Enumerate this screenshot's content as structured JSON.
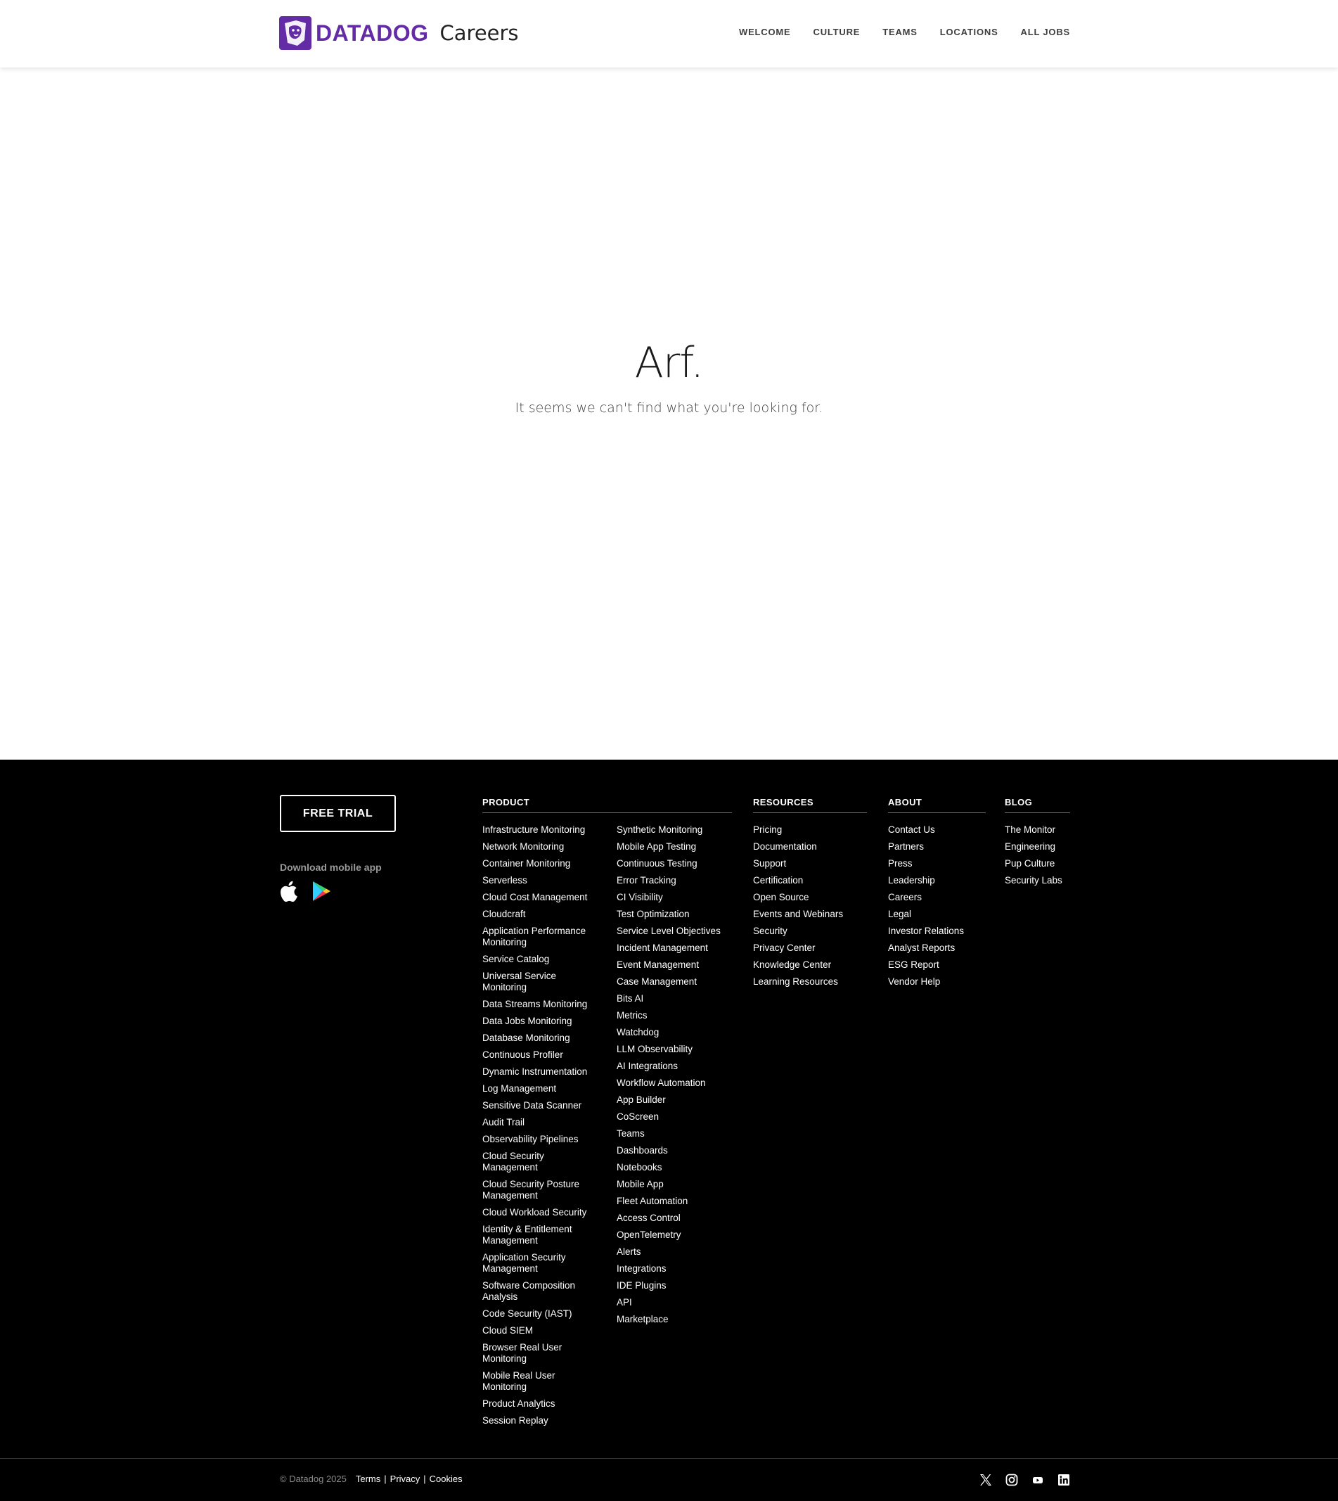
{
  "header": {
    "brand": "DATADOG",
    "subtitle": "Careers",
    "nav": [
      {
        "label": "WELCOME"
      },
      {
        "label": "CULTURE"
      },
      {
        "label": "TEAMS"
      },
      {
        "label": "LOCATIONS"
      },
      {
        "label": "ALL JOBS"
      }
    ]
  },
  "error": {
    "heading": "Arf.",
    "message": "It seems we can't find what you're looking for."
  },
  "footer": {
    "cta_label": "FREE TRIAL",
    "mobile_label": "Download mobile app",
    "store_icons": [
      "apple-icon",
      "google-play-icon"
    ],
    "columns": {
      "product": {
        "heading": "PRODUCT",
        "col1": [
          "Infrastructure Monitoring",
          "Network Monitoring",
          "Container Monitoring",
          "Serverless",
          "Cloud Cost Management",
          "Cloudcraft",
          "Application Performance Monitoring",
          "Service Catalog",
          "Universal Service Monitoring",
          "Data Streams Monitoring",
          "Data Jobs Monitoring",
          "Database Monitoring",
          "Continuous Profiler",
          "Dynamic Instrumentation",
          "Log Management",
          "Sensitive Data Scanner",
          "Audit Trail",
          "Observability Pipelines",
          "Cloud Security Management",
          "Cloud Security Posture Management",
          "Cloud Workload Security",
          "Identity & Entitlement Management",
          "Application Security Management",
          "Software Composition Analysis",
          "Code Security (IAST)",
          "Cloud SIEM",
          "Browser Real User Monitoring",
          "Mobile Real User Monitoring",
          "Product Analytics",
          "Session Replay"
        ],
        "col2": [
          "Synthetic Monitoring",
          "Mobile App Testing",
          "Continuous Testing",
          "Error Tracking",
          "CI Visibility",
          "Test Optimization",
          "Service Level Objectives",
          "Incident Management",
          "Event Management",
          "Case Management",
          "Bits AI",
          "Metrics",
          "Watchdog",
          "LLM Observability",
          "AI Integrations",
          "Workflow Automation",
          "App Builder",
          "CoScreen",
          "Teams",
          "Dashboards",
          "Notebooks",
          "Mobile App",
          "Fleet Automation",
          "Access Control",
          "OpenTelemetry",
          "Alerts",
          "Integrations",
          "IDE Plugins",
          "API",
          "Marketplace"
        ]
      },
      "resources": {
        "heading": "RESOURCES",
        "items": [
          "Pricing",
          "Documentation",
          "Support",
          "Certification",
          "Open Source",
          "Events and Webinars",
          "Security",
          "Privacy Center",
          "Knowledge Center",
          "Learning Resources"
        ]
      },
      "about": {
        "heading": "ABOUT",
        "items": [
          "Contact Us",
          "Partners",
          "Press",
          "Leadership",
          "Careers",
          "Legal",
          "Investor Relations",
          "Analyst Reports",
          "ESG Report",
          "Vendor Help"
        ]
      },
      "blog": {
        "heading": "BLOG",
        "items": [
          "The Monitor",
          "Engineering",
          "Pup Culture",
          "Security Labs"
        ]
      }
    },
    "legal": {
      "copyright": "© Datadog 2025",
      "links": [
        "Terms",
        "Privacy",
        "Cookies"
      ]
    },
    "social_icons": [
      "x-icon",
      "instagram-icon",
      "youtube-icon",
      "linkedin-icon"
    ]
  }
}
